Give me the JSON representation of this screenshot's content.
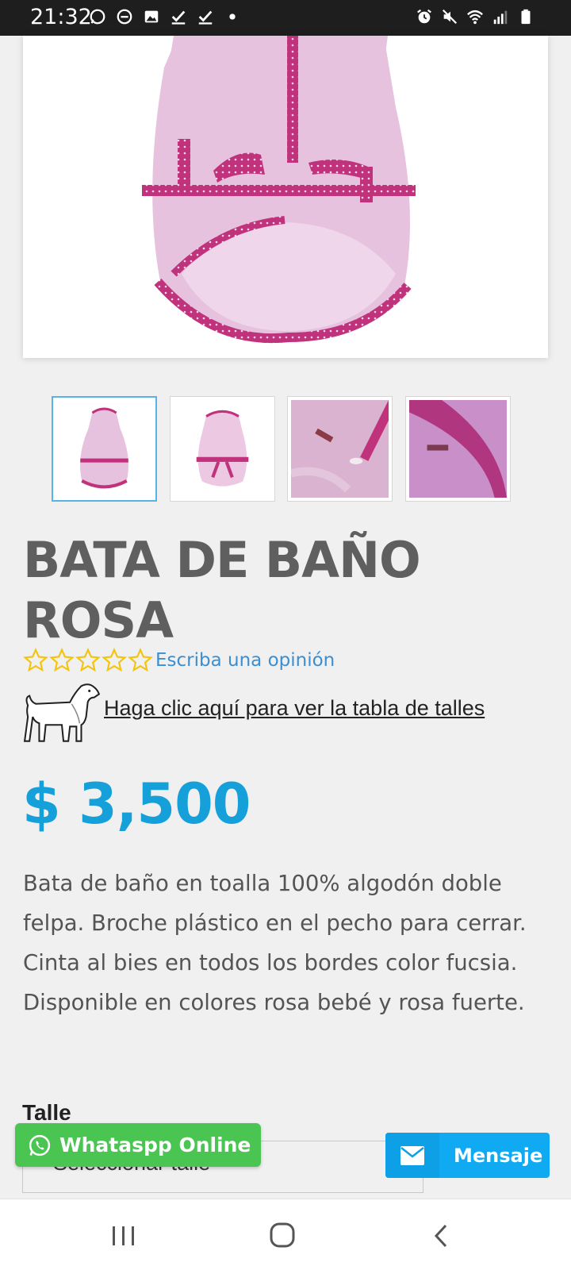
{
  "status_bar": {
    "time": "21:32"
  },
  "product": {
    "title": "BATA DE BAÑO ROSA",
    "rating_stars": 5,
    "rating_value": 0,
    "review_link": "Escriba una opinión",
    "size_table_link": "Haga clic aquí para ver la tabla de talles",
    "price": "$ 3,500",
    "description": "Bata de baño en toalla 100% algodón doble felpa. Broche plástico en el pecho para cerrar. Cinta al bies en todos los bordes color fucsia. Disponible en colores rosa bebé y rosa fuerte.",
    "thumbnails": [
      "thumb-1",
      "thumb-2",
      "thumb-3",
      "thumb-4"
    ],
    "selected_thumbnail": 0
  },
  "size_select": {
    "label": "Talle",
    "selected": "--Seleccionar talle--"
  },
  "floating": {
    "whatsapp_label": "Whataspp Online",
    "message_label": "Mensaje"
  },
  "colors": {
    "price": "#16a0d9",
    "link": "#3b8fd1",
    "whatsapp": "#4bc552",
    "message": "#10aaf2",
    "star": "#f2c40f",
    "robe_pink": "#e7c2df",
    "trim_fuchsia": "#c0337c"
  }
}
